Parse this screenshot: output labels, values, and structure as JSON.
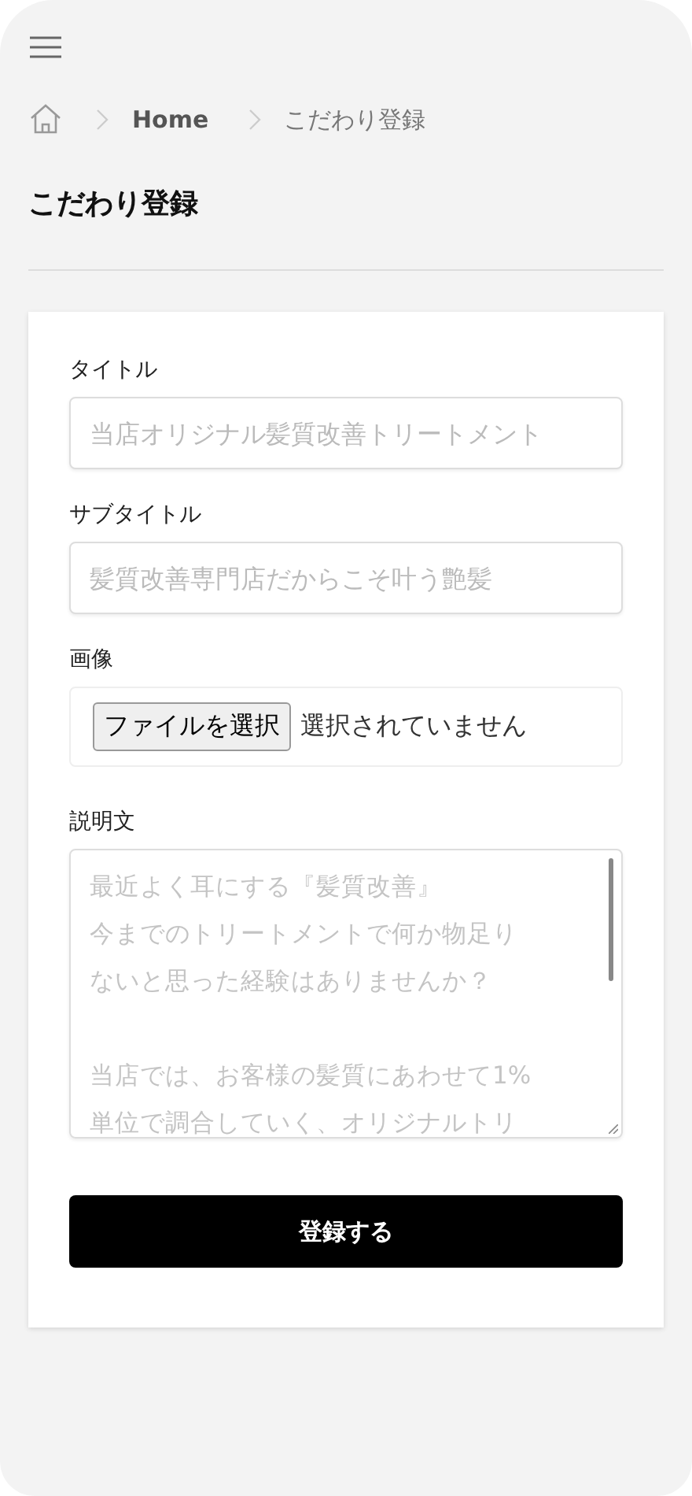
{
  "breadcrumb": [
    "Home",
    "こだわり登録"
  ],
  "page_title": "こだわり登録",
  "form": {
    "fields": [
      {
        "kind": "text",
        "label": "タイトル",
        "placeholder": "当店オリジナル髪質改善トリートメント"
      },
      {
        "kind": "text",
        "label": "サブタイトル",
        "placeholder": "髪質改善専門店だからこそ叶う艶髪"
      },
      {
        "kind": "file",
        "label": "画像",
        "button": "ファイルを選択",
        "status": "選択されていません"
      },
      {
        "kind": "textarea",
        "label": "説明文",
        "placeholder_paragraphs": [
          [
            "最近よく耳にする『髪質改善』",
            "今までのトリートメントで何か物足り",
            "ないと思った経験はありませんか？"
          ],
          [
            "当店では、お客様の髪質にあわせて1%",
            "単位で調合していく、オリジナルトリ"
          ]
        ]
      }
    ],
    "submit": "登録する"
  }
}
